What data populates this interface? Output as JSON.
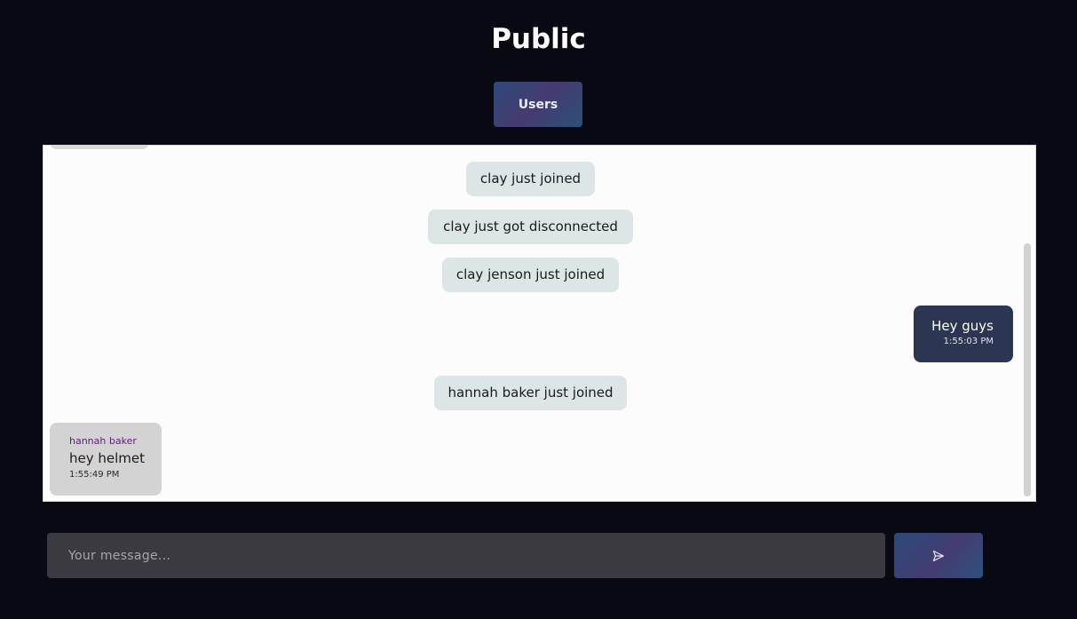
{
  "header": {
    "title": "Public",
    "users_button_label": "Users"
  },
  "chat": {
    "system_messages": [
      "clay just joined",
      "clay just got disconnected",
      "clay jenson just joined",
      "hannah baker just joined"
    ],
    "outgoing": {
      "text": "Hey guys",
      "time": "1:55:03 PM"
    },
    "incoming": {
      "sender": "hannah baker",
      "text": "hey helmet",
      "time": "1:55:49 PM"
    }
  },
  "composer": {
    "placeholder": "Your message...",
    "value": ""
  },
  "send_button": {
    "icon": "send-icon"
  },
  "colors": {
    "background": "#090914",
    "chat_panel": "#fcfcfc",
    "system_bubble": "#dde6e7",
    "outgoing_bubble": "#2c3552",
    "incoming_bubble": "#d3d3d3",
    "sender_name": "#5b1f7a",
    "input": "#3a3a40"
  }
}
